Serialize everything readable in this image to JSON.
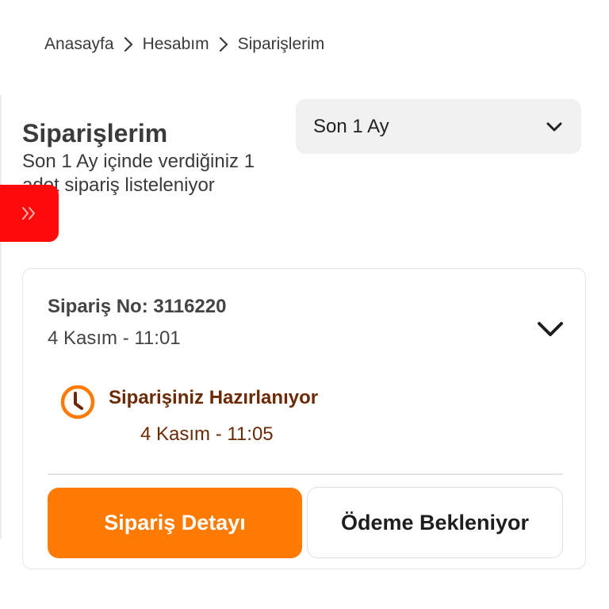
{
  "breadcrumb": {
    "items": [
      {
        "label": "Anasayfa"
      },
      {
        "label": "Hesabım"
      },
      {
        "label": "Siparişlerim"
      }
    ],
    "separator_icon": "chevron-right-icon"
  },
  "header": {
    "title": "Siparişlerim",
    "subtitle": "Son 1 Ay içinde verdiğiniz 1 adet sipariş listeleniyor"
  },
  "period_filter": {
    "selected": "Son 1 Ay",
    "icon": "chevron-down-icon"
  },
  "side_tab": {
    "icon": "double-chevron-right-icon",
    "color": "#ff0a0a"
  },
  "orders": [
    {
      "order_no": "Sipariş No: 3116220",
      "date": "4 Kasım - 11:01",
      "status": {
        "icon": "clock-icon",
        "label": "Siparişiniz Hazırlanıyor",
        "date": "4 Kasım - 11:05",
        "color": "#6b2a04"
      },
      "actions": {
        "detail_label": "Sipariş Detayı",
        "payment_label": "Ödeme Bekleniyor"
      }
    }
  ],
  "colors": {
    "accent": "#ff7a00",
    "status_text": "#6b2a04"
  }
}
